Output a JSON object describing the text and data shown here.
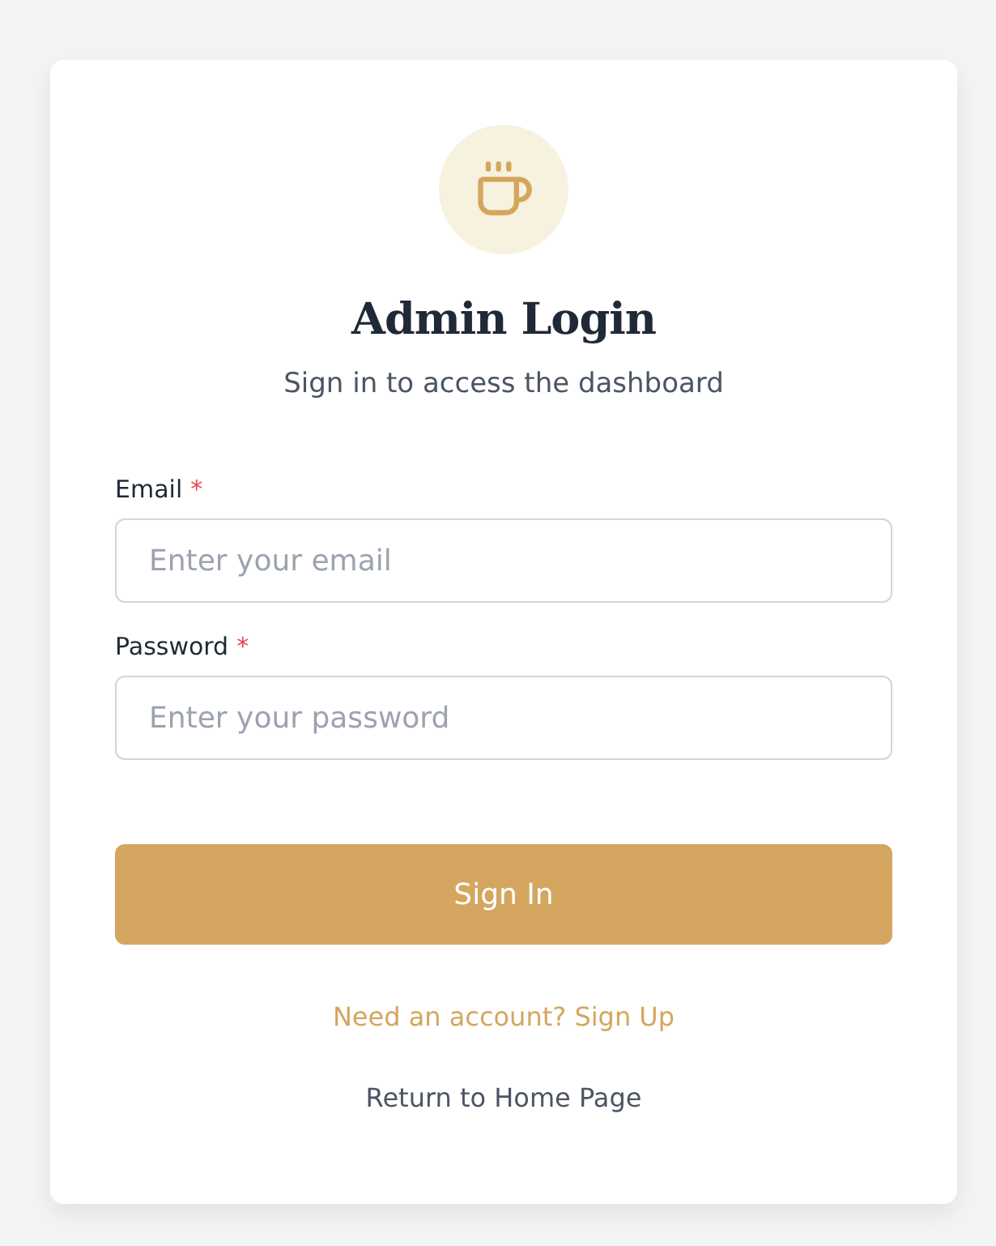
{
  "card": {
    "title": "Admin Login",
    "subtitle": "Sign in to access the dashboard"
  },
  "fields": [
    {
      "label": "Email",
      "required_mark": "*",
      "placeholder": "Enter your email"
    },
    {
      "label": "Password",
      "required_mark": "*",
      "placeholder": "Enter your password"
    }
  ],
  "submit_button": "Sign In",
  "links": [
    {
      "text": "Need an account? Sign Up",
      "kind": "accent"
    },
    {
      "text": "Return to Home Page",
      "kind": "muted"
    }
  ]
}
